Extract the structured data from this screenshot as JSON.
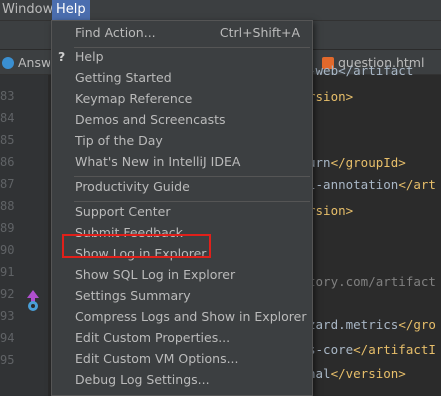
{
  "menubar": {
    "window_label": "Window",
    "help_label": "Help"
  },
  "tabs": {
    "left_label": "Answe",
    "right_label": "question.html"
  },
  "editor": {
    "line_numbers": [
      "83",
      "84",
      "85",
      "86",
      "87",
      "88",
      "89",
      "90",
      "91",
      "92",
      "93",
      "94",
      "95"
    ],
    "code": {
      "l83_tail": "-web</artifact",
      "l84_tag": "rsion>",
      "l87_txt": "urn",
      "l87_tag": "</groupId>",
      "l88_txt": "l-annotation",
      "l88_tag": "</art",
      "l89_tag": "rsion>",
      "l91_url": "tory.com/artifact",
      "l93_txt": "zard.metrics",
      "l93_tag": "</gro",
      "l94_txt": "s-core",
      "l94_tag": "</artifactI",
      "l95_txt": "nal",
      "l95_tag": "</version>"
    }
  },
  "help_menu": {
    "find_action": {
      "label": "Find Action...",
      "shortcut": "Ctrl+Shift+A"
    },
    "help_icon": "?",
    "help": "Help",
    "getting_started": "Getting Started",
    "keymap_reference": "Keymap Reference",
    "demos": "Demos and Screencasts",
    "tip_of_the_day": "Tip of the Day",
    "whats_new": "What's New in IntelliJ IDEA",
    "productivity_guide": "Productivity Guide",
    "support_center": "Support Center",
    "submit_feedback": "Submit Feedback",
    "show_log": "Show Log in Explorer",
    "show_sql_log": "Show SQL Log in Explorer",
    "settings_summary": "Settings Summary",
    "compress_logs": "Compress Logs and Show in Explorer",
    "edit_custom_properties": "Edit Custom Properties...",
    "edit_custom_vm": "Edit Custom VM Options...",
    "debug_log_settings": "Debug Log Settings..."
  },
  "colors": {
    "highlight_box": "#e0201a",
    "active_menu": "#4b6eaf"
  }
}
